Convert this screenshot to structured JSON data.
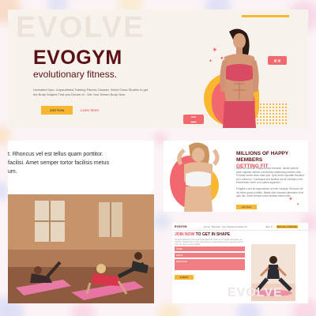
{
  "hero": {
    "watermark": "EVOLVE",
    "logo": "EVOGYM",
    "tagline": "evolutionary fitness.",
    "description": "Unrivaled Gym. Unparalleled Training Fitness Classes. World Class Studios to get the Body Shapes That you Dream of.. Get Your Dream Body Now.",
    "join_button": "Join Now",
    "learn_more": "Learn More"
  },
  "classes": {
    "lines": [
      "t. Rhoncus vel est tellus quam porttitor.",
      "facilisi. Amet semper tortor facilisis metus",
      "um."
    ]
  },
  "stats": {
    "title_prefix": "MILLIONS OF HAPPY MEMBERS",
    "title_highlight": "GETTING FIT",
    "paragraph": "Nascetur aenean massa auctor tincidunt. Iaculis potenti amet egestas ultrices consectetur adipiscing ultricies enim. Pulvinar fames vitae vitae quis. Quis amet vulputate tincidunt at in nulla nec. Consequat sed facilisis dui sit volutpat in elit. Elementum morbi ut ut platea dignissim.",
    "paragraph_2": "Fringilla a sed at suspendisse ut enim volutpat. Rhoncus vel est tellus quam porttitor. Mattis nibh euismod bibendum et at quis nec. Amet semper tortor facilisis metus nibh.",
    "button": "Join Now"
  },
  "contact": {
    "nav": {
      "logo": "EVOGYM",
      "links": [
        "Home",
        "Benefits",
        "Our Classes",
        "Contact Us",
        "Sign In",
        "Become a Member"
      ]
    },
    "title_highlight": "JOIN NOW",
    "title_rest": " TO GET IN SHAPE",
    "paragraph": "Congue adipiscing risus commodo placerat. Tellus et in feugiat nisl sapien vel rhoncus. Placerat at in enim pellentesque. Nulla adipiscing leo egestas nisi elit risus sit. Nunc cursus sagittis.",
    "fields": [
      "NAME",
      "EMAIL",
      "MESSAGE"
    ],
    "submit": "SUBMIT",
    "watermark": "EVOLVE"
  },
  "colors": {
    "brand_maroon": "#5a1016",
    "accent_pink": "#f2686f",
    "accent_yellow": "#f7b731",
    "background": "#f7f2ec"
  }
}
